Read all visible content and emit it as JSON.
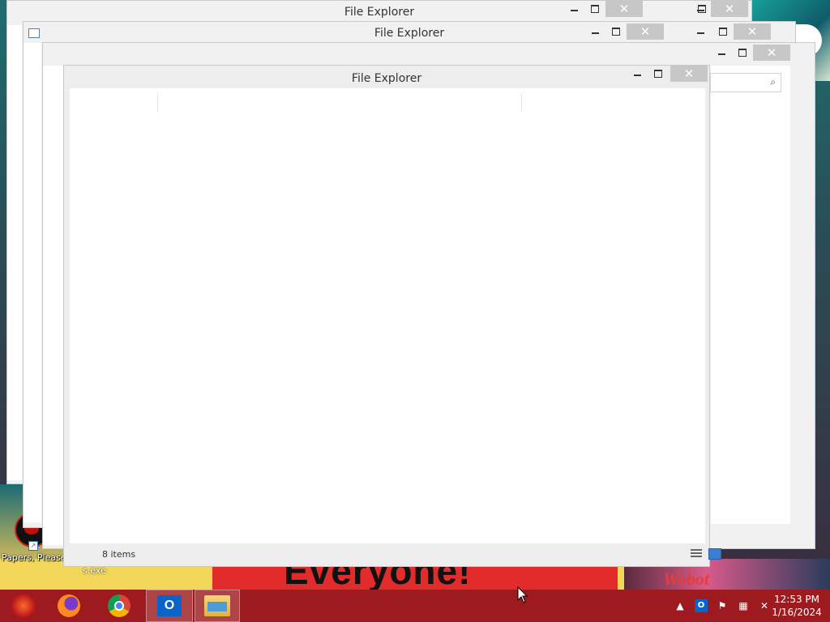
{
  "windows": {
    "back1_title": "File Explorer",
    "back2_title": "File Explorer",
    "front_title": "File Explorer",
    "status_items": "8 items"
  },
  "desktop": {
    "icon_label": "Papers, Please Forz",
    "icon_label_cont": "s.exe",
    "wallpaper_text": "Everyone!",
    "wallpaper_text_right": "Wobot"
  },
  "taskbar": {
    "items": [
      {
        "name": "start",
        "icon": "start-orb-icon"
      },
      {
        "name": "firefox",
        "icon": "firefox-icon"
      },
      {
        "name": "chrome",
        "icon": "chrome-icon"
      },
      {
        "name": "outlook",
        "icon": "outlook-icon",
        "label": "O"
      },
      {
        "name": "file-explorer",
        "icon": "folder-icon",
        "active": true
      }
    ],
    "time": "12:53 PM",
    "date": "1/16/2024"
  },
  "colors": {
    "taskbar": "#9d1b1f",
    "window_frame": "#f1f1f1",
    "close_button": "#c7c7c7"
  }
}
